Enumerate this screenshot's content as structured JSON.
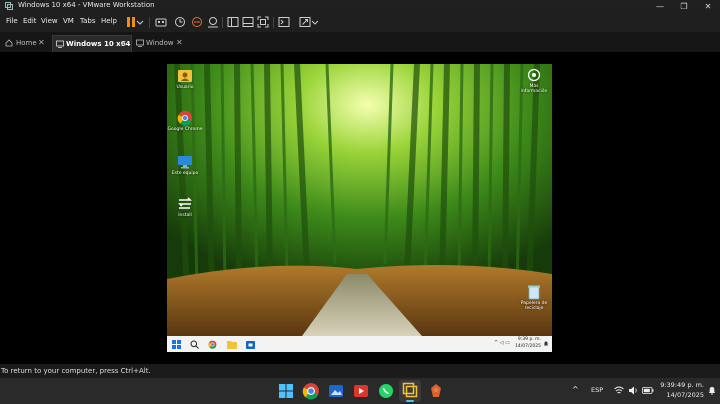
{
  "window": {
    "title": "Windows 10 x64 - VMware Workstation",
    "controls": {
      "minimize": "—",
      "maximize": "❐",
      "close": "✕"
    }
  },
  "menu": {
    "items": [
      "File",
      "Edit",
      "View",
      "VM",
      "Tabs",
      "Help"
    ]
  },
  "tabs": [
    {
      "label": "Home",
      "close": "✕"
    },
    {
      "label": "Windows 10 x64",
      "close": "✕"
    },
    {
      "label": "Window",
      "close": "✕"
    }
  ],
  "guest": {
    "desktop_icons": [
      {
        "label": "Usuario",
        "icon": "user-folder-icon"
      },
      {
        "label": "Google Chrome",
        "icon": "chrome-icon"
      },
      {
        "label": "Este equipo",
        "icon": "computer-icon"
      },
      {
        "label": "Install",
        "icon": "install-icon"
      }
    ],
    "top_right_icon": {
      "label": "Más información",
      "icon": "info-camera-icon"
    },
    "recycle_bin": {
      "label": "Papelera de reciclaje",
      "icon": "recycle-bin-icon"
    },
    "taskbar": {
      "time": "9:39 p. m.",
      "date": "14/07/2025"
    }
  },
  "status_bar": {
    "text": "To return to your computer, press Ctrl+Alt."
  },
  "host_taskbar": {
    "language": "ESP",
    "time": "9:39:49 p. m.",
    "date": "14/07/2025"
  },
  "colors": {
    "accent": "#f08c1c",
    "title_bg": "#202020",
    "bamboo_green": "#3d8a1a"
  }
}
